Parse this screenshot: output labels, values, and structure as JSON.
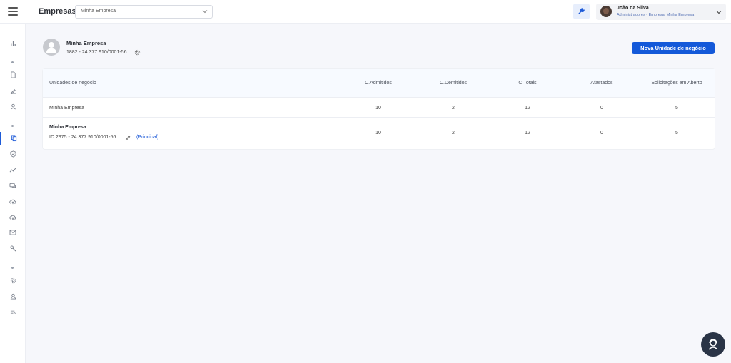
{
  "header": {
    "title": "Empresas",
    "company_select": {
      "value": "Minha Empresa"
    },
    "user": {
      "name": "João da Silva",
      "role": "Administradores - Empresa: Minha Empresa"
    }
  },
  "sidebar": {
    "items": [
      {
        "icon": "bar-chart-icon",
        "active": false
      },
      {
        "icon": "document-icon",
        "active": false
      },
      {
        "icon": "pen-icon",
        "active": false
      },
      {
        "icon": "person-icon",
        "active": false
      },
      {
        "icon": "copy-files-icon",
        "active": true
      },
      {
        "icon": "shield-check-icon",
        "active": false
      },
      {
        "icon": "trend-line-icon",
        "active": false
      },
      {
        "icon": "chat-icon",
        "active": false
      },
      {
        "icon": "cloud-upload-icon",
        "active": false
      },
      {
        "icon": "cloud-download-icon",
        "active": false
      },
      {
        "icon": "mail-icon",
        "active": false
      },
      {
        "icon": "wrench-icon",
        "active": false
      },
      {
        "icon": "gear-icon",
        "active": false
      },
      {
        "icon": "user-icon",
        "active": false
      },
      {
        "icon": "list-icon",
        "active": false
      }
    ]
  },
  "company": {
    "name": "Minha Empresa",
    "id_line": "1882 - 24.377.910/0001-56"
  },
  "new_unit_button": "Nova Unidade de negócio",
  "table": {
    "columns": [
      "Unidades de negócio",
      "C.Admitidos",
      "C.Demitidos",
      "C.Totais",
      "Afastados",
      "Solicitações em Aberto"
    ],
    "rows": [
      {
        "name": "Minha Empresa",
        "admitidos": "10",
        "demitidos": "2",
        "totais": "12",
        "afastados": "0",
        "solicitacoes": "5"
      },
      {
        "name": "Minha Empresa",
        "id_line": "ID 2975 - 24.377.910/0001-56",
        "tag": "(Principal)",
        "admitidos": "10",
        "demitidos": "2",
        "totais": "12",
        "afastados": "0",
        "solicitacoes": "5"
      }
    ]
  },
  "colors": {
    "primary": "#1459d9",
    "link": "#1e5bd8",
    "background": "#f6f7fb"
  }
}
